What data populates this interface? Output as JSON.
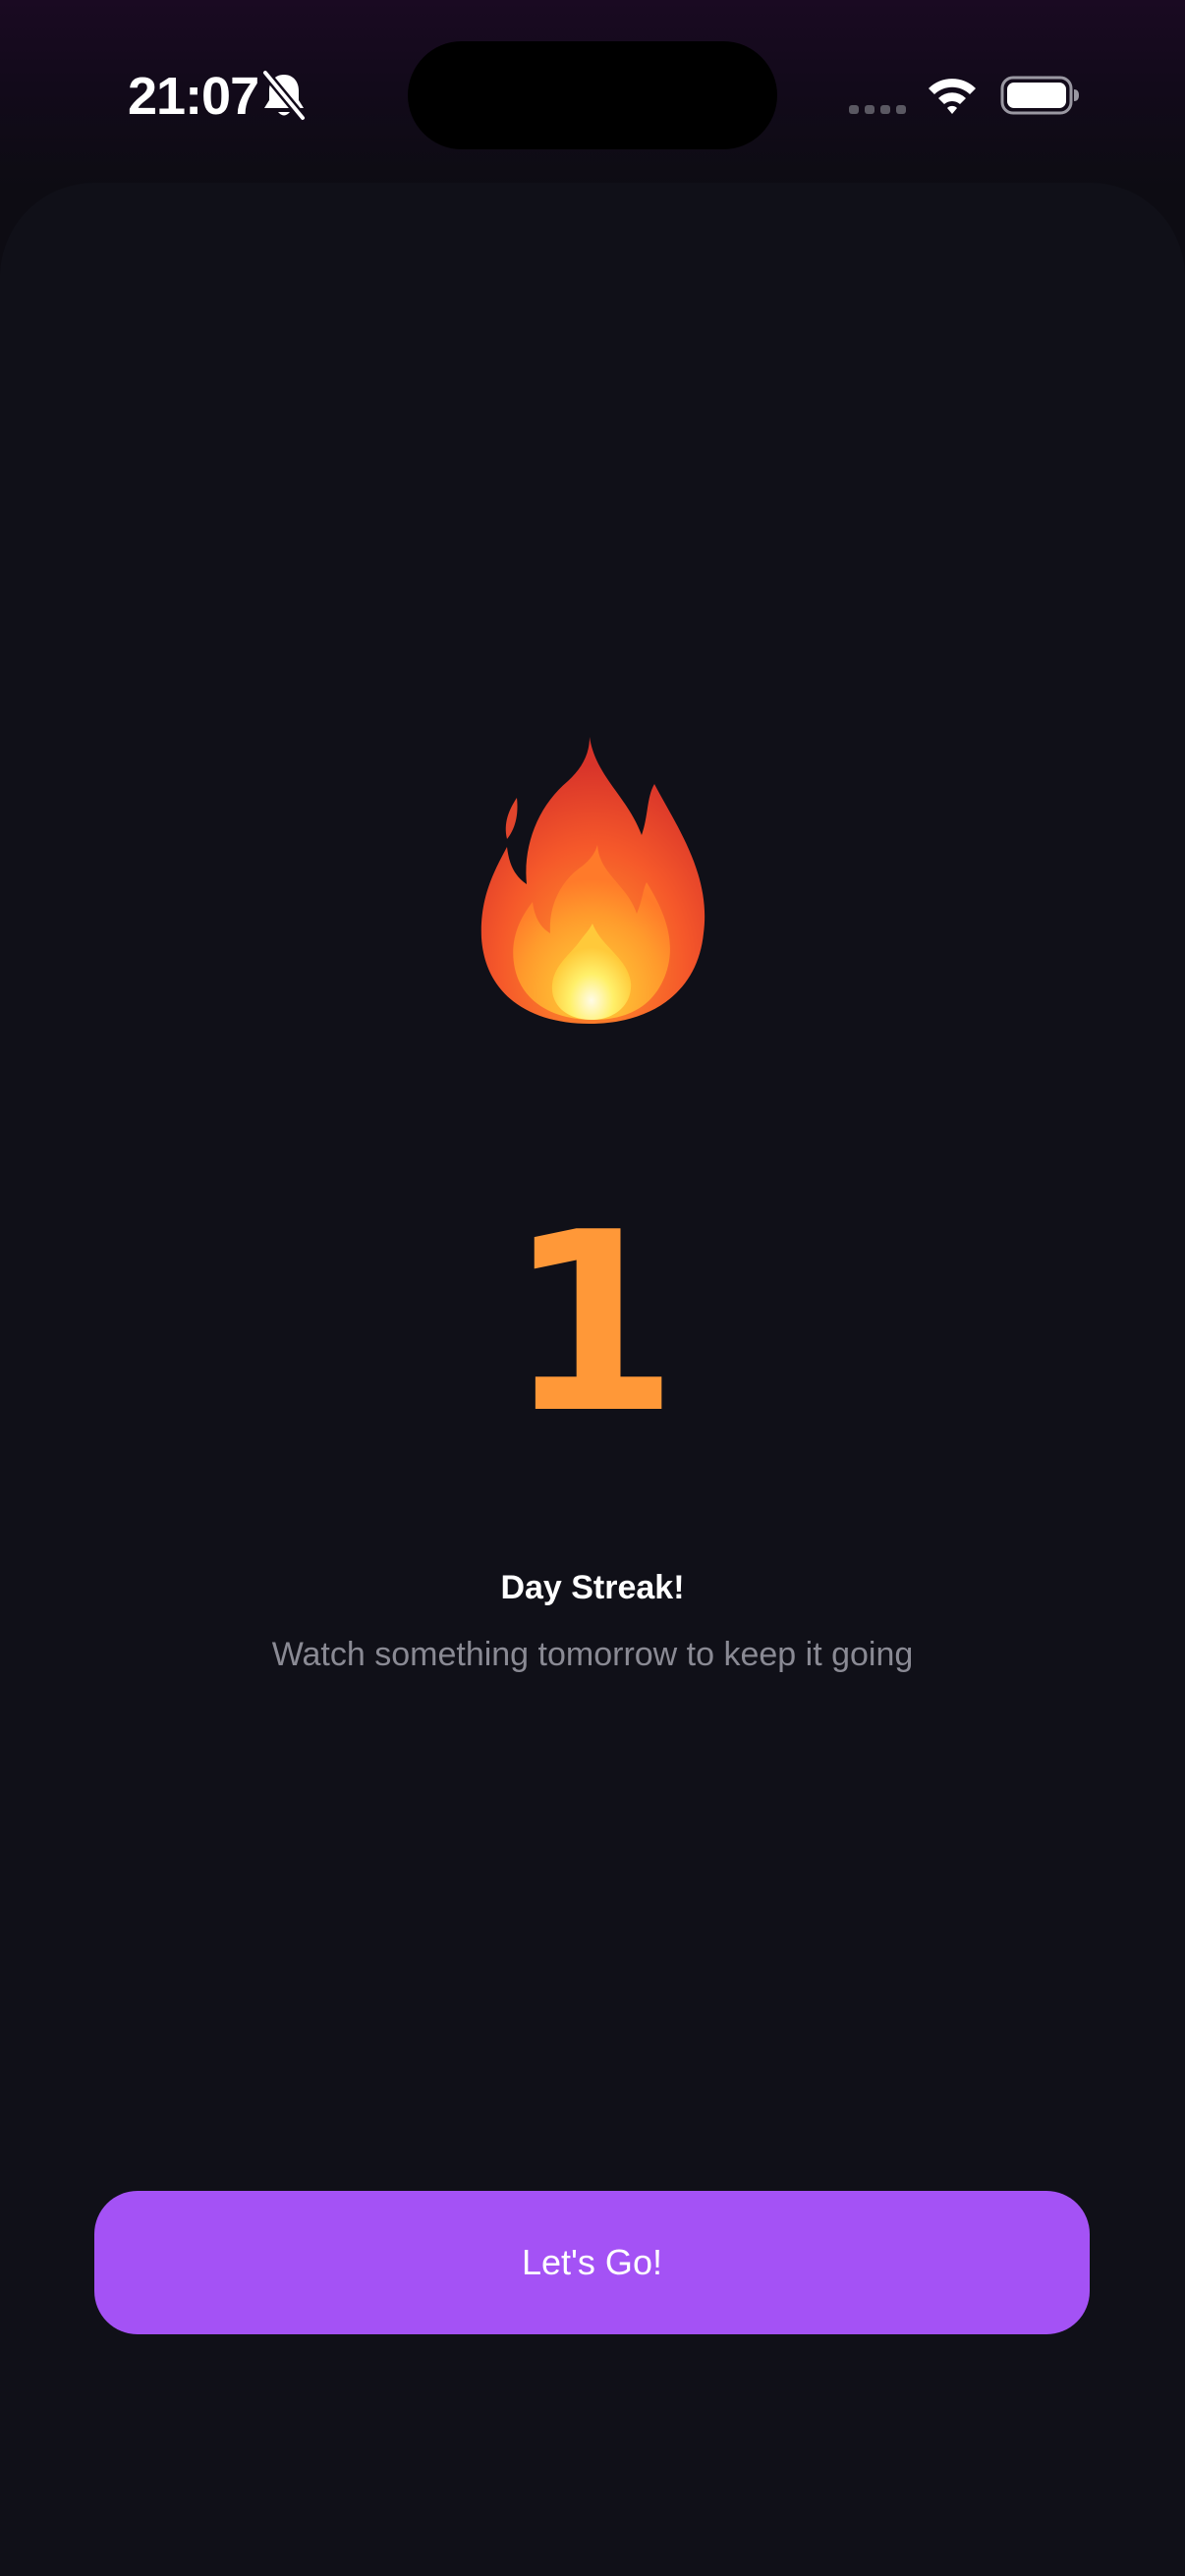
{
  "status_bar": {
    "time": "21:07",
    "icons": [
      "bell-slash-icon",
      "signal-icon",
      "wifi-icon",
      "battery-icon"
    ]
  },
  "streak": {
    "icon": "flame-icon",
    "count": "1",
    "title": "Day Streak!",
    "subtitle": "Watch something tomorrow to keep it going"
  },
  "actions": {
    "primary_label": "Let's Go!"
  },
  "colors": {
    "accent": "#a452f5",
    "streak_number": "#ff9838",
    "background": "#101018",
    "subtitle_text": "#8a8a94"
  }
}
